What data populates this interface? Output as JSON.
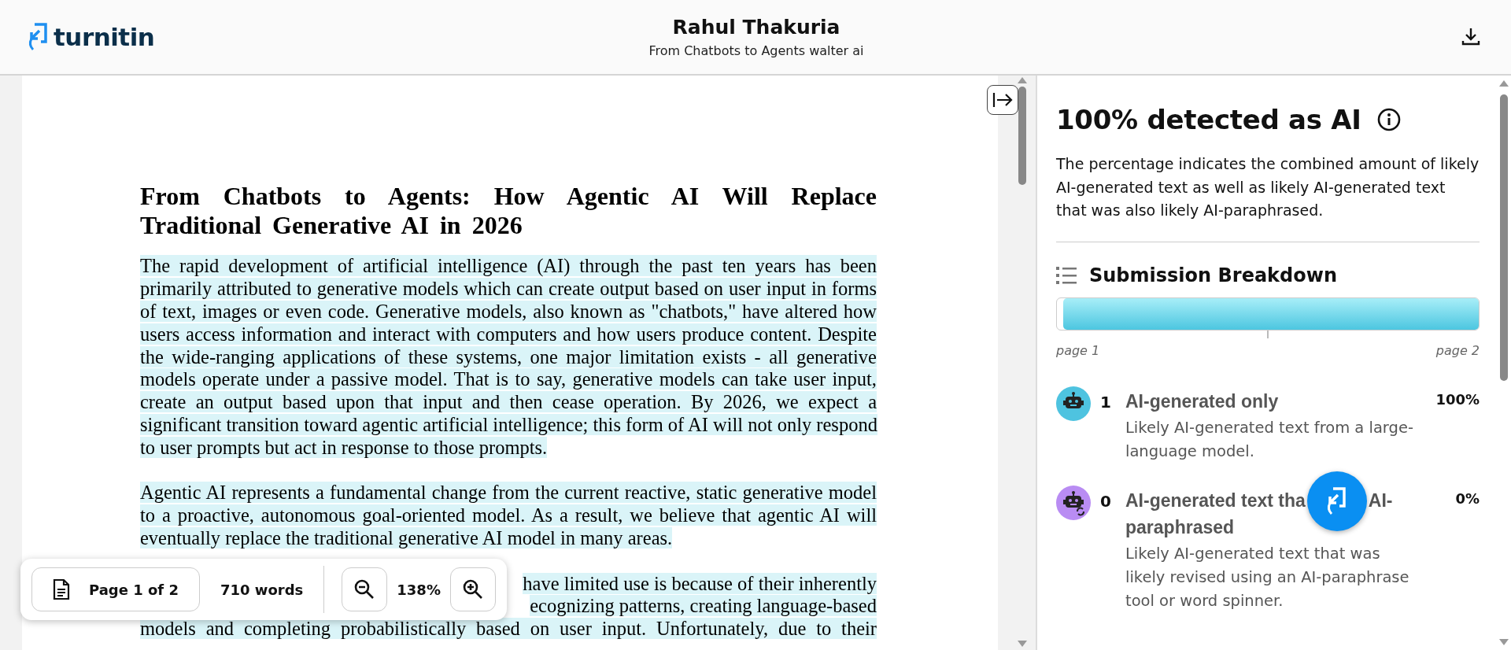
{
  "header": {
    "title": "Rahul Thakuria",
    "subtitle": "From Chatbots to Agents walter ai",
    "logo": "turnitin"
  },
  "document": {
    "title": "From Chatbots to Agents: How Agentic AI Will Replace Traditional Generative AI in 2026",
    "paragraphs": [
      {
        "kind": "full",
        "highlighted": true,
        "lines": [
          "The rapid development of artificial intelligence (AI) through the past ten years has been",
          "primarily attributed to generative models which can create output based on user input in forms",
          "of text, images or even code. Generative models, also known as \"chatbots,\" have altered how",
          "users access information and interact with computers and how users produce content. Despite",
          "the wide-ranging applications of these systems, one major limitation exists - all generative",
          "models operate under a passive model. That is to say, generative models can take user input,",
          "create an output based upon that input and then cease operation. By 2026, we expect a",
          "significant transition toward agentic artificial intelligence; this form of AI will not only respond",
          "to user prompts but act in response to those prompts."
        ]
      },
      {
        "kind": "full",
        "highlighted": true,
        "lines": [
          "Agentic AI represents a fundamental change from the current reactive, static generative model",
          "to a proactive, autonomous goal-oriented model. As a result, we believe that agentic AI will",
          "eventually replace the traditional generative AI model in many areas."
        ]
      },
      {
        "kind": "partial",
        "highlighted": true,
        "lines": [
          "have limited use is because of their inherently",
          "ecognizing patterns, creating language-based",
          "models and completing probabilistically based on user input. Unfortunately, due to their"
        ]
      }
    ]
  },
  "toolbar": {
    "page": "Page 1 of 2",
    "words": "710 words",
    "zoom": "138%"
  },
  "panel": {
    "heading": "100% detected as AI",
    "description": "The percentage indicates the combined amount of likely AI-generated text as well as likely AI-generated text that was also likely AI-paraphrased.",
    "breakdown": {
      "title": "Submission Breakdown",
      "level": 1,
      "start_label": "page 1",
      "end_label": "page 2"
    },
    "categories": [
      {
        "kind": "generated",
        "color": "#4ec3e0",
        "count": "1",
        "title_lines": [
          [
            "AI-generated only"
          ]
        ],
        "percent": "100%",
        "description": "Likely AI-generated text from a large-language model."
      },
      {
        "kind": "paraphrased",
        "color": "#b98cf3",
        "count": "0",
        "title_lines": [
          [
            "AI-generated text tha",
            "AI-"
          ],
          [
            "paraphrased"
          ]
        ],
        "percent": "0%",
        "description": "Likely AI-generated text that was likely revised using an AI-paraphrase tool or word spinner."
      }
    ]
  }
}
